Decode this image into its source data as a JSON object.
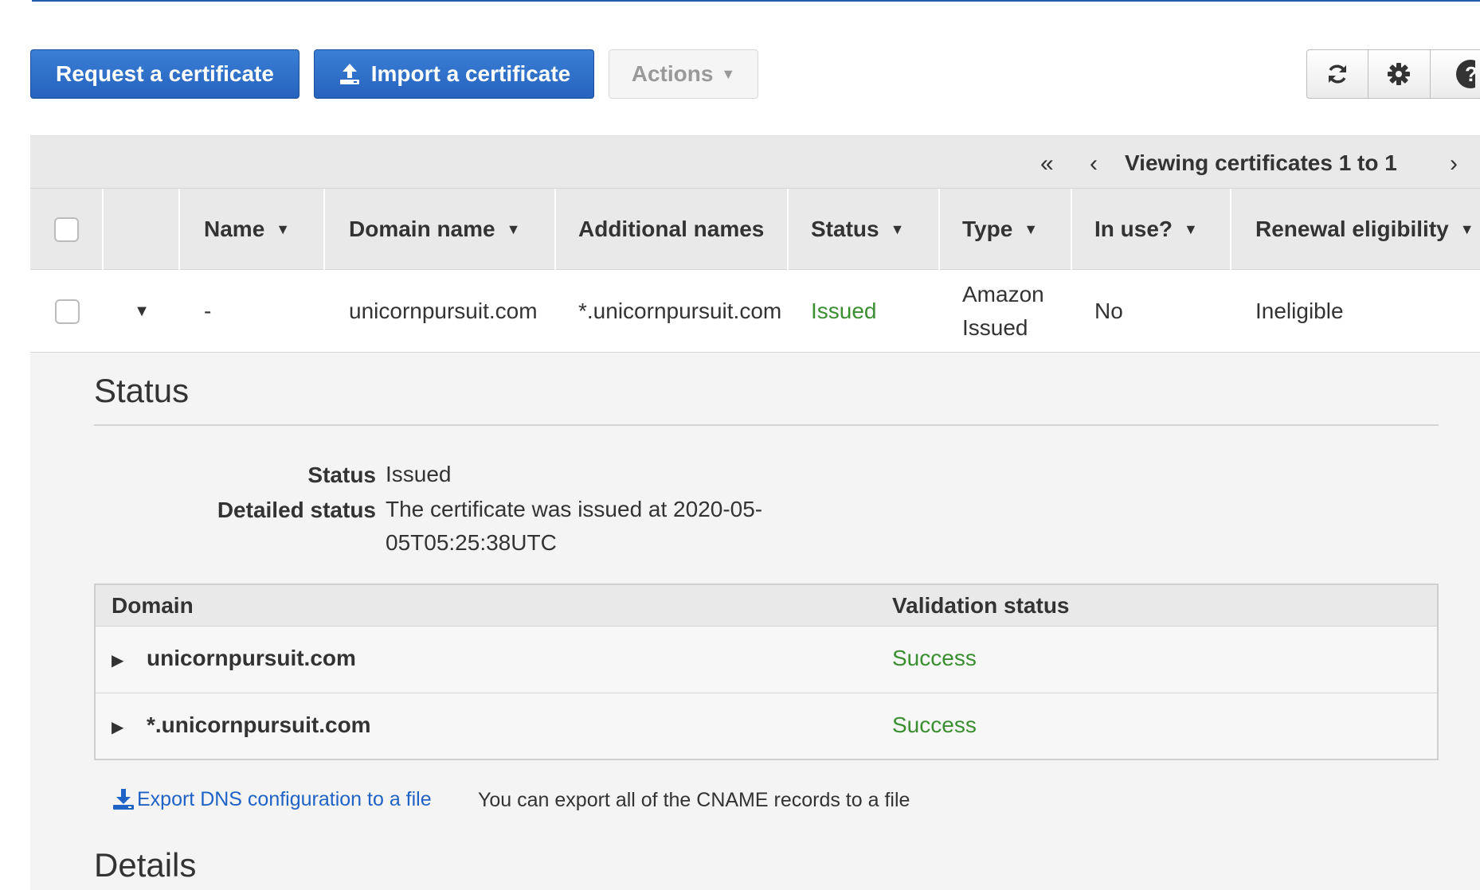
{
  "toolbar": {
    "request_label": "Request a certificate",
    "import_label": "Import a certificate",
    "actions_label": "Actions"
  },
  "pager": {
    "first": "«",
    "prev": "‹",
    "label": "Viewing certificates 1 to 1",
    "next": "›",
    "last": "»"
  },
  "table": {
    "columns": [
      "Name",
      "Domain name",
      "Additional names",
      "Status",
      "Type",
      "In use?",
      "Renewal eligibility"
    ],
    "row": {
      "name": "-",
      "domain": "unicornpursuit.com",
      "additional": "*.unicornpursuit.com",
      "status": "Issued",
      "type_line1": "Amazon",
      "type_line2": "Issued",
      "in_use": "No",
      "renewal": "Ineligible"
    }
  },
  "status_section": {
    "title": "Status",
    "status_label": "Status",
    "status_value": "Issued",
    "detailed_label": "Detailed status",
    "detailed_line1": "The certificate was issued at 2020-05-",
    "detailed_line2": "05T05:25:38UTC"
  },
  "validation": {
    "col_domain": "Domain",
    "col_status": "Validation status",
    "rows": [
      {
        "domain": "unicornpursuit.com",
        "status": "Success"
      },
      {
        "domain": "*.unicornpursuit.com",
        "status": "Success"
      }
    ]
  },
  "export": {
    "link_label": "Export DNS configuration to a file",
    "note": "You can export all of the CNAME records to a file"
  },
  "details_section": {
    "title": "Details"
  },
  "colors": {
    "primary": "#2663be",
    "success": "#3a8f30",
    "link": "#1f63c6"
  },
  "icons": [
    "upload-icon",
    "refresh-icon",
    "gear-icon",
    "help-icon",
    "download-icon",
    "sort-caret-icon",
    "expand-caret-icon"
  ]
}
